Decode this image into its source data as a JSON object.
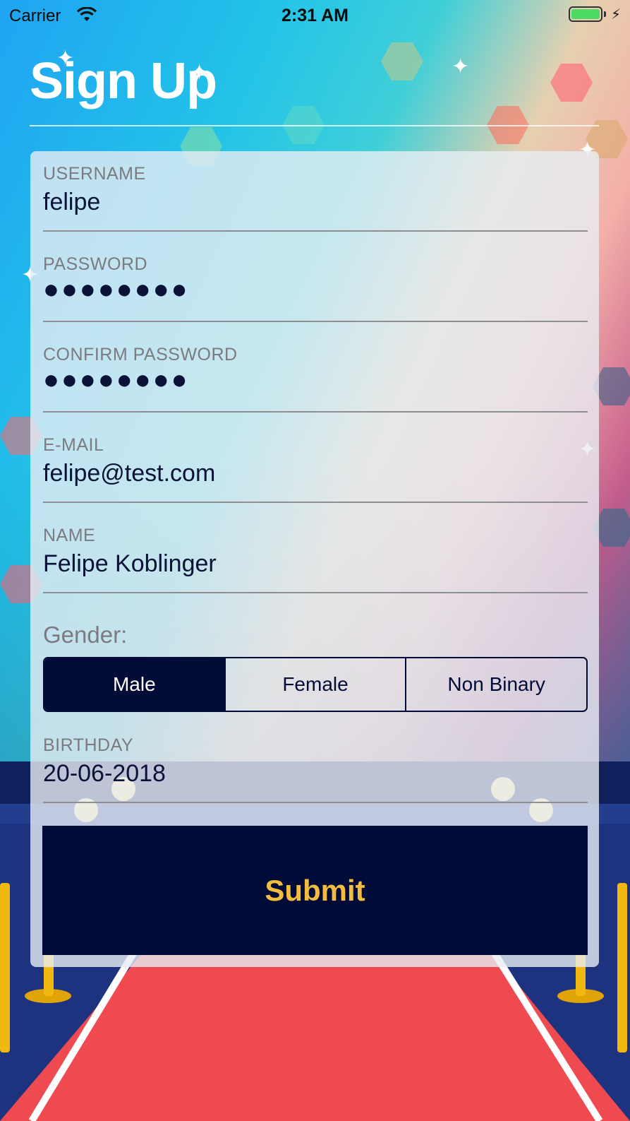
{
  "status_bar": {
    "carrier": "Carrier",
    "time": "2:31 AM",
    "battery_level": 1.0,
    "charging": true
  },
  "page": {
    "title": "Sign Up"
  },
  "form": {
    "fields": [
      {
        "label": "USERNAME",
        "value": "felipe"
      },
      {
        "label": "PASSWORD",
        "value": "●●●●●●●●"
      },
      {
        "label": "CONFIRM PASSWORD",
        "value": "●●●●●●●●"
      },
      {
        "label": "E-MAIL",
        "value": "felipe@test.com"
      },
      {
        "label": "NAME",
        "value": "Felipe Koblinger"
      }
    ],
    "gender": {
      "label": "Gender:",
      "options": [
        "Male",
        "Female",
        "Non Binary"
      ],
      "selected": "Male"
    },
    "birthday": {
      "label": "BIRTHDAY",
      "value": "20-06-2018"
    },
    "submit_label": "Submit"
  },
  "colors": {
    "primary_dark": "#000b37",
    "submit_text": "#f2bd3f",
    "label_gray": "#7b7b80"
  }
}
